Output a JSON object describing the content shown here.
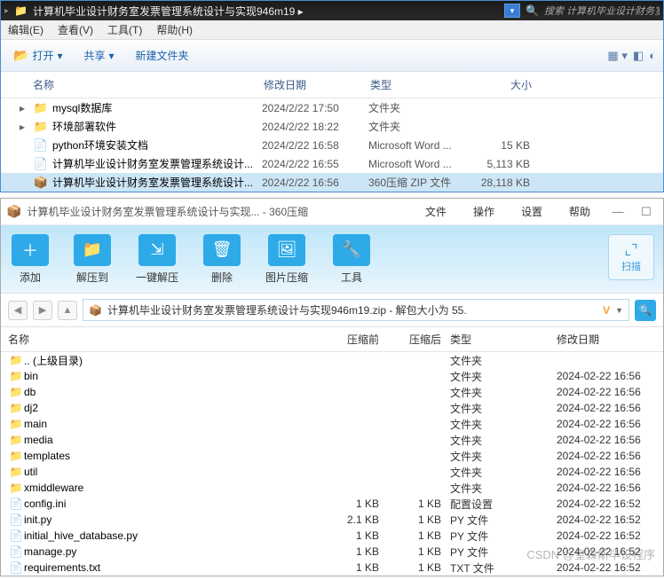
{
  "explorer": {
    "path_prefix": "▸",
    "path_text": "计算机毕业设计财务室发票管理系统设计与实现946m19 ▸",
    "search_placeholder": "搜索 计算机毕业设计财务室发票管理...",
    "menu": {
      "edit": "编辑(E)",
      "view": "查看(V)",
      "tools": "工具(T)",
      "help": "帮助(H)"
    },
    "toolbar": {
      "open": "打开",
      "share": "共享",
      "newfolder": "新建文件夹"
    },
    "columns": {
      "name": "名称",
      "date": "修改日期",
      "type": "类型",
      "size": "大小"
    },
    "rows": [
      {
        "icon": "folder",
        "name": "mysql数据库",
        "date": "2024/2/22 17:50",
        "type": "文件夹",
        "size": ""
      },
      {
        "icon": "folder",
        "name": "环境部署软件",
        "date": "2024/2/22 18:22",
        "type": "文件夹",
        "size": ""
      },
      {
        "icon": "word",
        "name": "python环境安装文档",
        "date": "2024/2/22 16:58",
        "type": "Microsoft Word ...",
        "size": "15 KB"
      },
      {
        "icon": "word",
        "name": "计算机毕业设计财务室发票管理系统设计...",
        "date": "2024/2/22 16:55",
        "type": "Microsoft Word ...",
        "size": "5,113 KB"
      },
      {
        "icon": "zip",
        "name": "计算机毕业设计财务室发票管理系统设计...",
        "date": "2024/2/22 16:56",
        "type": "360压缩 ZIP 文件",
        "size": "28,118 KB",
        "selected": true
      }
    ]
  },
  "zip": {
    "title": "计算机毕业设计财务室发票管理系统设计与实现... - 360压缩",
    "menus": {
      "file": "文件",
      "operate": "操作",
      "settings": "设置",
      "help": "帮助"
    },
    "tools": {
      "add": "添加",
      "extractto": "解压到",
      "oneclick": "一键解压",
      "delete": "删除",
      "imgcompress": "图片压缩",
      "tool": "工具"
    },
    "scan": "扫描",
    "path_text": "计算机毕业设计财务室发票管理系统设计与实现946m19.zip - 解包大小为 55.",
    "columns": {
      "name": "名称",
      "before": "压缩前",
      "after": "压缩后",
      "type": "类型",
      "date": "修改日期"
    },
    "rows": [
      {
        "icon": "folder",
        "name": ".. (上级目录)",
        "before": "",
        "after": "",
        "type": "文件夹",
        "date": ""
      },
      {
        "icon": "folder",
        "name": "bin",
        "before": "",
        "after": "",
        "type": "文件夹",
        "date": "2024-02-22 16:56"
      },
      {
        "icon": "folder",
        "name": "db",
        "before": "",
        "after": "",
        "type": "文件夹",
        "date": "2024-02-22 16:56"
      },
      {
        "icon": "folder",
        "name": "dj2",
        "before": "",
        "after": "",
        "type": "文件夹",
        "date": "2024-02-22 16:56"
      },
      {
        "icon": "folder",
        "name": "main",
        "before": "",
        "after": "",
        "type": "文件夹",
        "date": "2024-02-22 16:56"
      },
      {
        "icon": "folder",
        "name": "media",
        "before": "",
        "after": "",
        "type": "文件夹",
        "date": "2024-02-22 16:56"
      },
      {
        "icon": "folder",
        "name": "templates",
        "before": "",
        "after": "",
        "type": "文件夹",
        "date": "2024-02-22 16:56"
      },
      {
        "icon": "folder",
        "name": "util",
        "before": "",
        "after": "",
        "type": "文件夹",
        "date": "2024-02-22 16:56"
      },
      {
        "icon": "folder",
        "name": "xmiddleware",
        "before": "",
        "after": "",
        "type": "文件夹",
        "date": "2024-02-22 16:56"
      },
      {
        "icon": "file",
        "name": "config.ini",
        "before": "1 KB",
        "after": "1 KB",
        "type": "配置设置",
        "date": "2024-02-22 16:52"
      },
      {
        "icon": "file",
        "name": "init.py",
        "before": "2.1 KB",
        "after": "1 KB",
        "type": "PY 文件",
        "date": "2024-02-22 16:52"
      },
      {
        "icon": "file",
        "name": "initial_hive_database.py",
        "before": "1 KB",
        "after": "1 KB",
        "type": "PY 文件",
        "date": "2024-02-22 16:52"
      },
      {
        "icon": "file",
        "name": "manage.py",
        "before": "1 KB",
        "after": "1 KB",
        "type": "PY 文件",
        "date": "2024-02-22 16:52"
      },
      {
        "icon": "file",
        "name": "requirements.txt",
        "before": "1 KB",
        "after": "1 KB",
        "type": "TXT 文件",
        "date": "2024-02-22 16:52"
      }
    ]
  },
  "watermark": "CSDN @皇森斯毕设程序"
}
